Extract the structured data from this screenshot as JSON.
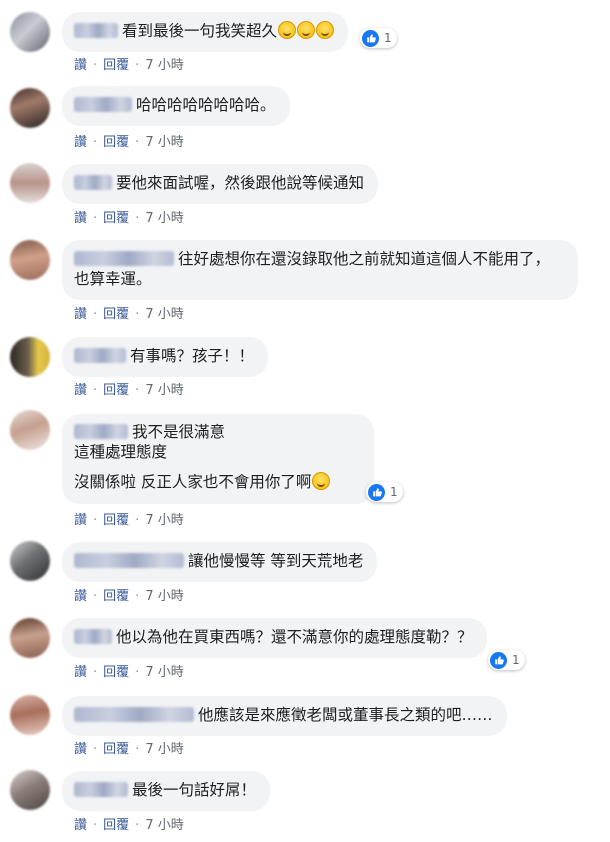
{
  "actions": {
    "like": "讚",
    "reply": "回覆",
    "separator": "·",
    "time": "7 小時"
  },
  "colors": {
    "bubble": "#f2f3f5",
    "like_blue": "#1877f2",
    "action_link": "#385898"
  },
  "comments": [
    {
      "text": "看到最後一句我笑超久",
      "emoji": "grinning-face x3",
      "reactions": "1"
    },
    {
      "text": "哈哈哈哈哈哈哈哈。"
    },
    {
      "text": "要他來面試喔，然後跟他說等候通知"
    },
    {
      "text": "往好處想你在還沒錄取他之前就知道這個人不能用了，也算幸運。"
    },
    {
      "text": "有事嗎？孩子！！"
    },
    {
      "line1": "我不是很滿意",
      "line2": "這種處理態度",
      "line3": "沒關係啦 反正人家也不會用你了啊",
      "emoji": "smiling-face",
      "reactions": "1"
    },
    {
      "text": "讓他慢慢等 等到天荒地老"
    },
    {
      "text": "他以為他在買東西嗎？還不滿意你的處理態度勒？？",
      "reactions": "1"
    },
    {
      "text": "他應該是來應徵老闆或董事長之類的吧……"
    },
    {
      "text": "最後一句話好屌！"
    }
  ]
}
